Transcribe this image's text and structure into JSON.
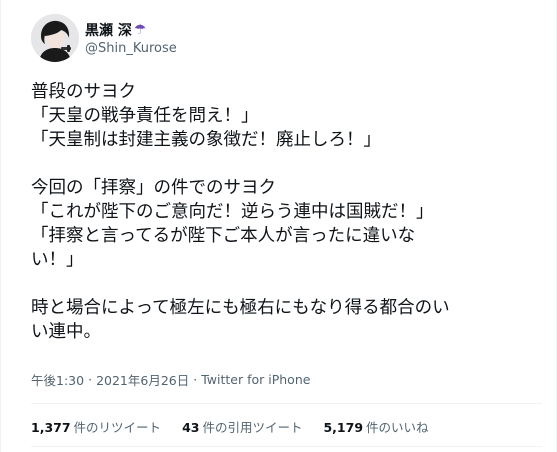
{
  "user": {
    "display_name": "黒瀬 深",
    "name_emoji": "☂",
    "handle": "@Shin_Kurose",
    "avatar_icon": "avatar-icon"
  },
  "tweet": {
    "lines": [
      "普段のサヨク",
      "「天皇の戦争責任を問え！」",
      "「天皇制は封建主義の象徴だ！廃止しろ！」",
      "",
      "今回の「拝察」の件でのサヨク",
      "「これが陛下のご意向だ！逆らう連中は国賊だ！」",
      "「拝察と言ってるが陛下ご本人が言ったに違いな",
      "い！」",
      "",
      "時と場合によって極左にも極右にもなり得る都合のい",
      "い連中。"
    ]
  },
  "meta": {
    "time": "午後1:30",
    "separator": "·",
    "date": "2021年6月26日",
    "source": "Twitter for iPhone"
  },
  "stats": {
    "retweets_count": "1,377",
    "retweets_label": "件のリツイート",
    "quotes_count": "43",
    "quotes_label": "件の引用ツイート",
    "likes_count": "5,179",
    "likes_label": "件のいいね"
  },
  "colors": {
    "text": "#0f1419",
    "secondary": "#536471",
    "divider": "#eff3f4",
    "emoji": "#6e4bb8"
  }
}
